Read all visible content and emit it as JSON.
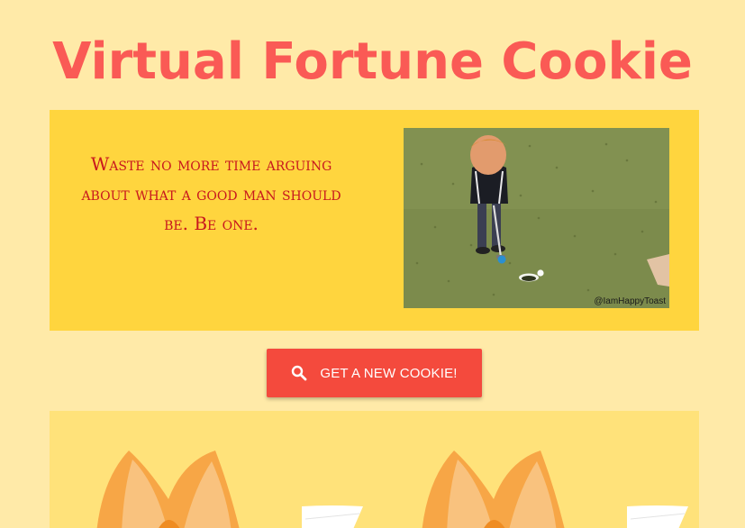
{
  "page": {
    "title": "Virtual Fortune Cookie"
  },
  "fortune": {
    "text": "Waste no more time arguing about what a good man should be. Be one."
  },
  "gif": {
    "watermark": "@IamHappyToast"
  },
  "actions": {
    "new_cookie_label": "Get a new cookie!",
    "icon": "search-icon"
  },
  "colors": {
    "background": "#ffeaa8",
    "title": "#fa5a55",
    "card": "#ffd53e",
    "fortune_text": "#c8181e",
    "button": "#f44a3d",
    "cookie_area": "#ffe27a"
  }
}
